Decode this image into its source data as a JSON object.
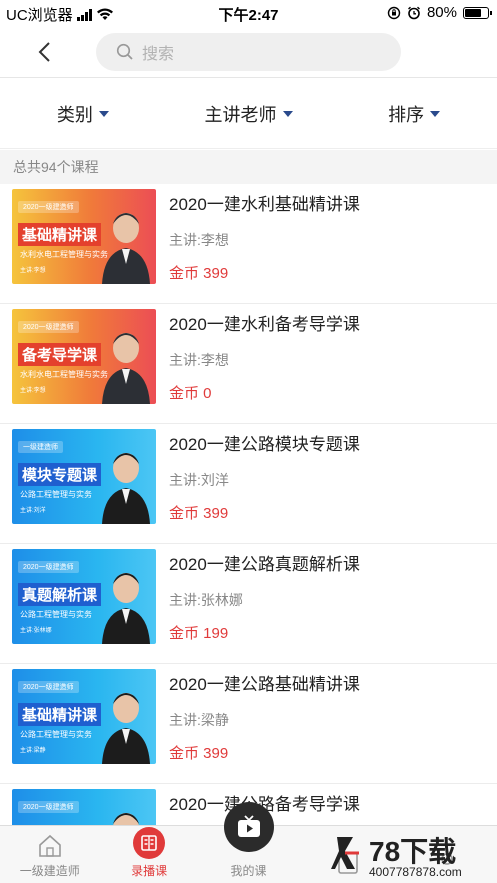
{
  "status_bar": {
    "carrier": "UC浏览器",
    "time": "下午2:47",
    "battery_text": "80%",
    "battery_level": 0.8
  },
  "nav": {
    "search_placeholder": "搜索"
  },
  "filters": [
    {
      "label": "类别"
    },
    {
      "label": "主讲老师"
    },
    {
      "label": "排序"
    }
  ],
  "course_count_text": "总共94个课程",
  "courses": [
    {
      "title": "2020一建水利基础精讲课",
      "teacher": "主讲:李想",
      "price": "金币 399",
      "thumb": {
        "theme": "orange",
        "tag": "2020一级建造师",
        "big": "基础精讲课",
        "sub": "水利水电工程管理与实务",
        "who": "主讲:李想"
      }
    },
    {
      "title": "2020一建水利备考导学课",
      "teacher": "主讲:李想",
      "price": "金币 0",
      "thumb": {
        "theme": "orange",
        "tag": "2020一级建造师",
        "big": "备考导学课",
        "sub": "水利水电工程管理与实务",
        "who": "主讲:李想"
      }
    },
    {
      "title": "2020一建公路模块专题课",
      "teacher": "主讲:刘洋",
      "price": "金币 399",
      "thumb": {
        "theme": "blue",
        "tag": "一级建造师",
        "big": "模块专题课",
        "sub": "公路工程管理与实务",
        "who": "主讲:刘洋"
      }
    },
    {
      "title": "2020一建公路真题解析课",
      "teacher": "主讲:张林娜",
      "price": "金币 199",
      "thumb": {
        "theme": "blue",
        "tag": "2020一级建造师",
        "big": "真题解析课",
        "sub": "公路工程管理与实务",
        "who": "主讲:张林娜"
      }
    },
    {
      "title": "2020一建公路基础精讲课",
      "teacher": "主讲:梁静",
      "price": "金币 399",
      "thumb": {
        "theme": "blue",
        "tag": "2020一级建造师",
        "big": "基础精讲课",
        "sub": "公路工程管理与实务",
        "who": "主讲:梁静"
      }
    },
    {
      "title": "2020一建公路备考导学课",
      "teacher": "",
      "price": "",
      "thumb": {
        "theme": "blue",
        "tag": "2020一级建造师",
        "big": "",
        "sub": "",
        "who": ""
      }
    }
  ],
  "tabs": [
    {
      "label": "一级建造师",
      "icon": "home-icon",
      "active": false
    },
    {
      "label": "录播课",
      "icon": "book-icon",
      "active": true
    },
    {
      "label": "我的课",
      "icon": "play-icon",
      "active": false
    },
    {
      "label": "",
      "icon": "doc-icon",
      "active": false
    },
    {
      "label": "",
      "icon": "user-icon",
      "active": false
    }
  ],
  "watermark": {
    "brand": "78下载",
    "url": "4007787878.com"
  },
  "colors": {
    "accent": "#e03a3a",
    "caret": "#2a4a8c",
    "price": "#e03a3a"
  }
}
